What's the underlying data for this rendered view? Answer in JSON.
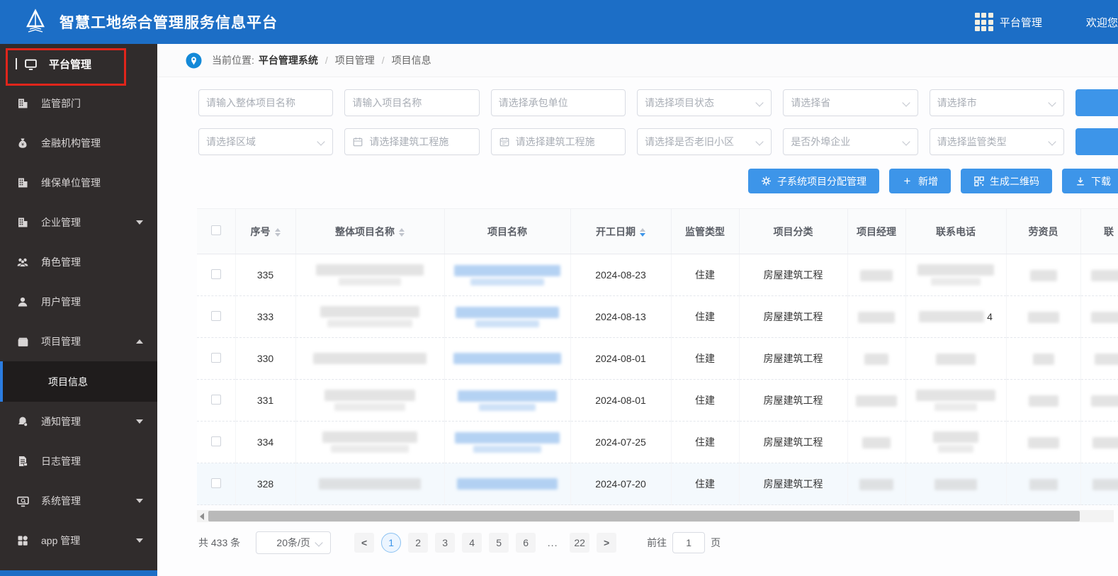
{
  "colors": {
    "primary": "#1c6ec6",
    "button_blue": "#3d95e9",
    "sidebar_bg": "#302c2c",
    "highlight_red": "#e0251b",
    "active_page_blue": "#3d95e9"
  },
  "header": {
    "title": "智慧工地综合管理服务信息平台",
    "nav_platform": "平台管理",
    "welcome": "欢迎您:"
  },
  "sidebar": {
    "items": [
      {
        "label": "平台管理"
      },
      {
        "label": "监管部门"
      },
      {
        "label": "金融机构管理"
      },
      {
        "label": "维保单位管理"
      },
      {
        "label": "企业管理"
      },
      {
        "label": "角色管理"
      },
      {
        "label": "用户管理"
      },
      {
        "label": "项目管理"
      },
      {
        "label": "项目信息"
      },
      {
        "label": "通知管理"
      },
      {
        "label": "日志管理"
      },
      {
        "label": "系统管理"
      },
      {
        "label": "app 管理"
      }
    ]
  },
  "breadcrumb": {
    "prefix": "当前位置:",
    "root": "平台管理系统",
    "sep": "/",
    "level2": "项目管理",
    "level3": "项目信息"
  },
  "filters": {
    "overall_name": "请输入整体项目名称",
    "project_name": "请输入项目名称",
    "contractor": "请选择承包单位",
    "status": "请选择项目状态",
    "province": "请选择省",
    "city": "请选择市",
    "region": "请选择区域",
    "date_start": "请选择建筑工程施",
    "date_end": "请选择建筑工程施",
    "old_community": "请选择是否老旧小区",
    "external_enterprise": "是否外埠企业",
    "supervision_type": "请选择监管类型"
  },
  "actions": {
    "assign": "子系统项目分配管理",
    "add": "新增",
    "qrcode": "生成二维码",
    "download": "下载"
  },
  "table": {
    "columns": {
      "serial": "序号",
      "overall_name": "整体项目名称",
      "project_name": "项目名称",
      "start_date": "开工日期",
      "supervision": "监管类型",
      "category": "项目分类",
      "manager": "项目经理",
      "phone": "联系电话",
      "labor": "劳资员",
      "last": "联"
    },
    "rows": [
      {
        "serial": "335",
        "start_date": "2024-08-23",
        "supervision": "住建",
        "category": "房屋建筑工程",
        "phone_suffix": ""
      },
      {
        "serial": "333",
        "start_date": "2024-08-13",
        "supervision": "住建",
        "category": "房屋建筑工程",
        "phone_suffix": "4"
      },
      {
        "serial": "330",
        "start_date": "2024-08-01",
        "supervision": "住建",
        "category": "房屋建筑工程",
        "phone_suffix": ""
      },
      {
        "serial": "331",
        "start_date": "2024-08-01",
        "supervision": "住建",
        "category": "房屋建筑工程",
        "phone_suffix": ""
      },
      {
        "serial": "334",
        "start_date": "2024-07-25",
        "supervision": "住建",
        "category": "房屋建筑工程",
        "phone_suffix": ""
      },
      {
        "serial": "328",
        "start_date": "2024-07-20",
        "supervision": "住建",
        "category": "房屋建筑工程",
        "phone_suffix": ""
      }
    ]
  },
  "pagination": {
    "total": "共 433 条",
    "page_size": "20条/页",
    "prev": "<",
    "next": ">",
    "pages": [
      "1",
      "2",
      "3",
      "4",
      "5",
      "6",
      "...",
      "22"
    ],
    "goto_label": "前往",
    "goto_value": "1",
    "goto_suffix": "页"
  }
}
